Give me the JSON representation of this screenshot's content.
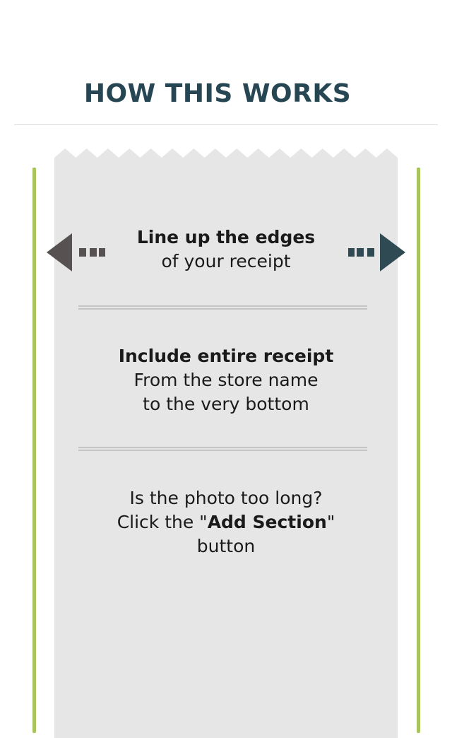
{
  "header": {
    "title": "HOW THIS WORKS"
  },
  "colors": {
    "accent_green": "#a8c45c",
    "title": "#264653",
    "receipt_bg": "#e6e6e6",
    "arrow_left": "#575251",
    "arrow_right": "#2f4a52"
  },
  "icons": {
    "left": "arrow-left-dashed-icon",
    "right": "arrow-right-dashed-icon"
  },
  "steps": [
    {
      "bold": "Line up the edges",
      "text": "of your receipt"
    },
    {
      "bold": "Include entire receipt",
      "line2": "From the store name",
      "line3": "to the very bottom"
    },
    {
      "line1": "Is the photo too long?",
      "prefix": "Click the \"",
      "bold": "Add Section",
      "suffix": "\"",
      "line3": "button"
    }
  ]
}
